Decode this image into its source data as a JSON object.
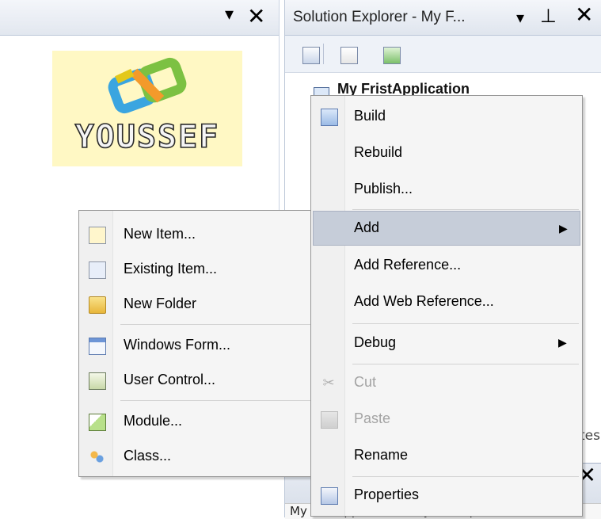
{
  "designer_panel": {
    "title_controls": {
      "dropdown": "▾",
      "close": "✕"
    },
    "logo_text": "YOUSSEF"
  },
  "solution_explorer": {
    "title": "Solution Explorer - My F...",
    "title_controls": {
      "dropdown": "▾",
      "pin": "⊥",
      "close": "✕"
    },
    "toolbar_icons": [
      "properties-icon",
      "show-all-files-icon",
      "refresh-icon"
    ],
    "tree_root_label": "My FristApplication",
    "partial_text": "tes",
    "properties_partial": {
      "close": "✕",
      "subtitle": "My FristApplication Project Prope"
    }
  },
  "project_context_menu": {
    "items": [
      {
        "label": "Build",
        "icon": "build-icon",
        "enabled": true
      },
      {
        "label": "Rebuild",
        "enabled": true
      },
      {
        "label": "Publish...",
        "enabled": true
      },
      {
        "label": "Add",
        "enabled": true,
        "submenu": true,
        "highlighted": true
      },
      {
        "label": "Add Reference...",
        "enabled": true
      },
      {
        "label": "Add Web Reference...",
        "enabled": true
      },
      {
        "label": "Debug",
        "enabled": true,
        "submenu": true
      },
      {
        "label": "Cut",
        "icon": "cut-icon",
        "enabled": false
      },
      {
        "label": "Paste",
        "icon": "paste-icon",
        "enabled": false
      },
      {
        "label": "Rename",
        "enabled": true
      },
      {
        "label": "Properties",
        "icon": "properties-icon",
        "enabled": true
      }
    ],
    "submenu_arrow": "▶"
  },
  "add_submenu": {
    "items": [
      {
        "label": "New Item...",
        "icon": "new-item-icon"
      },
      {
        "label": "Existing Item...",
        "icon": "existing-item-icon"
      },
      {
        "label": "New Folder",
        "icon": "folder-icon"
      },
      {
        "label": "Windows Form...",
        "icon": "windows-form-icon"
      },
      {
        "label": "User Control...",
        "icon": "user-control-icon"
      },
      {
        "label": "Module...",
        "icon": "module-icon"
      },
      {
        "label": "Class...",
        "icon": "class-icon"
      }
    ]
  },
  "colors": {
    "menu_bg": "#f5f5f5",
    "highlight": "#c6cdd9",
    "logo_bg": "#fff8c4",
    "disabled_text": "#a3a3a3"
  }
}
